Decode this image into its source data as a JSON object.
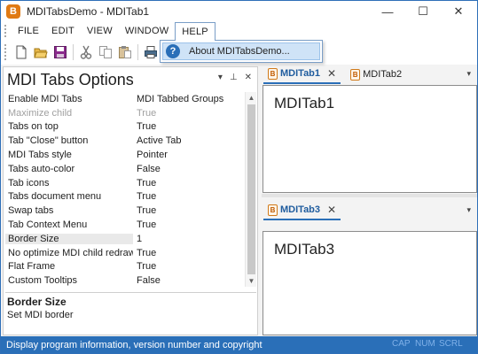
{
  "window": {
    "title": "MDITabsDemo - MDITab1",
    "app_icon_glyph": "B",
    "minimize_glyph": "—",
    "maximize_glyph": "☐",
    "close_glyph": "✕"
  },
  "menu": {
    "items": [
      "FILE",
      "EDIT",
      "VIEW",
      "WINDOW",
      "HELP"
    ],
    "open_menu": "HELP",
    "dropdown": {
      "items": [
        {
          "label": "About MDITabsDemo...",
          "icon": "help-circle-icon",
          "icon_glyph": "?"
        }
      ]
    }
  },
  "toolbar": {
    "buttons": [
      "new-file-icon",
      "open-folder-icon",
      "save-icon",
      "cut-icon",
      "copy-icon",
      "paste-icon",
      "print-icon"
    ]
  },
  "options_panel": {
    "title": "MDI Tabs Options",
    "dropdown_glyph": "▾",
    "pin_glyph": "⊥",
    "close_glyph": "✕",
    "properties": [
      {
        "name": "Enable MDI Tabs",
        "value": "MDI Tabbed Groups",
        "disabled": false
      },
      {
        "name": "Maximize child",
        "value": "True",
        "disabled": true
      },
      {
        "name": "Tabs on top",
        "value": "True",
        "disabled": false
      },
      {
        "name": "Tab \"Close\" button",
        "value": "Active Tab",
        "disabled": false
      },
      {
        "name": "MDI Tabs style",
        "value": "Pointer",
        "disabled": false
      },
      {
        "name": "Tabs auto-color",
        "value": "False",
        "disabled": false
      },
      {
        "name": "Tab icons",
        "value": "True",
        "disabled": false
      },
      {
        "name": "Tabs document menu",
        "value": "True",
        "disabled": false
      },
      {
        "name": "Swap tabs",
        "value": "True",
        "disabled": false
      },
      {
        "name": "Tab Context Menu",
        "value": "True",
        "disabled": false
      },
      {
        "name": "Border Size",
        "value": "1",
        "disabled": false,
        "selected": true
      },
      {
        "name": "No optimize MDI child redraw",
        "value": "True",
        "disabled": false
      },
      {
        "name": "Flat Frame",
        "value": "True",
        "disabled": false
      },
      {
        "name": "Custom Tooltips",
        "value": "False",
        "disabled": false
      }
    ],
    "description": {
      "title": "Border Size",
      "text": "Set MDI border"
    }
  },
  "mdi": {
    "group1": {
      "tabs": [
        {
          "label": "MDITab1",
          "active": true
        },
        {
          "label": "MDITab2",
          "active": false
        }
      ],
      "close_glyph": "✕",
      "menu_glyph": "▾",
      "content": "MDITab1"
    },
    "group2": {
      "tabs": [
        {
          "label": "MDITab3",
          "active": true
        }
      ],
      "close_glyph": "✕",
      "menu_glyph": "▾",
      "content": "MDITab3"
    },
    "tab_icon_glyph": "B"
  },
  "statusbar": {
    "text": "Display program information, version number and copyright",
    "indicators": [
      "CAP",
      "NUM",
      "SCRL"
    ]
  },
  "colors": {
    "accent": "#2a6fb8",
    "tab_icon": "#d07a1a",
    "selection": "#cfe3f7"
  }
}
